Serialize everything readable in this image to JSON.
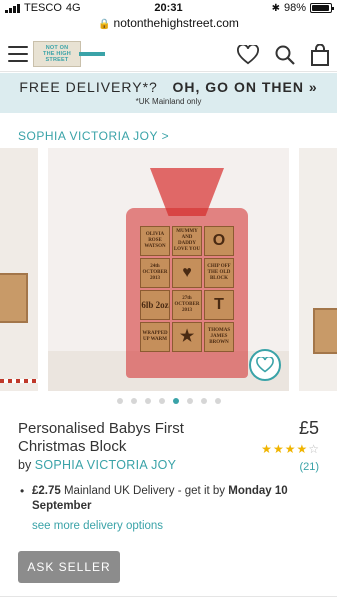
{
  "status": {
    "carrier": "TESCO",
    "network": "4G",
    "time": "20:31",
    "battery": "98%"
  },
  "url": "notonthehighstreet.com",
  "logo": {
    "line1": "NOT ON",
    "line2": "THE HIGH",
    "line3": "STREET"
  },
  "banner": {
    "left": "FREE DELIVERY*?",
    "right": "OH, GO ON THEN »",
    "note": "*UK Mainland only"
  },
  "breadcrumb": "SOPHIA VICTORIA JOY >",
  "image_blocks": [
    "OLIVIA ROSE WATSON",
    "MUMMY AND DADDY LOVE YOU",
    "O",
    "24th OCTOBER 2013",
    "♥",
    "CHIP OFF THE OLD BLOCK",
    "6lb 2oz",
    "27th OCTOBER 2013",
    "T",
    "WRAPPED UP WARM",
    "★",
    "THOMAS JAMES BROWN"
  ],
  "carousel": {
    "count": 8,
    "active": 4
  },
  "product": {
    "title": "Personalised Babys First Christmas Block",
    "price": "£5",
    "by_prefix": "by",
    "seller": "SOPHIA VICTORIA JOY",
    "rating": 4,
    "rating_max": 5,
    "reviews": "(21)"
  },
  "delivery": {
    "price": "£2.75",
    "text": " Mainland UK Delivery - get it by ",
    "date": "Monday 10 September",
    "more": "see more delivery options"
  },
  "ask_seller": "ASK SELLER",
  "colors": {
    "accent": "#3aa3a8",
    "banner_bg": "#dcecef",
    "star": "#f0b400",
    "button": "#8c8c8c"
  }
}
